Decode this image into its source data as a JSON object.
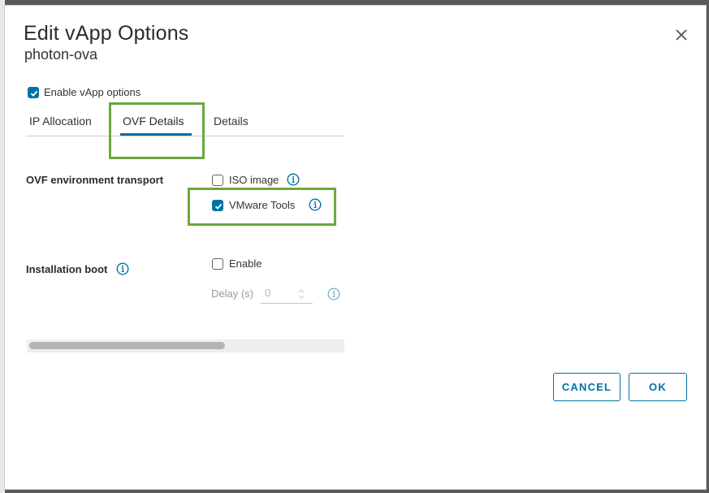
{
  "dialog": {
    "title": "Edit vApp Options",
    "subtitle": "photon-ova",
    "close_icon": "close-icon"
  },
  "enable_vapp": {
    "label": "Enable vApp options",
    "checked": true
  },
  "tabs": [
    {
      "label": "IP Allocation",
      "active": false
    },
    {
      "label": "OVF Details",
      "active": true
    },
    {
      "label": "Details",
      "active": false
    }
  ],
  "ovf_transport": {
    "label": "OVF environment transport",
    "options": [
      {
        "label": "ISO image",
        "checked": false,
        "icon": "info-icon"
      },
      {
        "label": "VMware Tools",
        "checked": true,
        "icon": "info-icon"
      }
    ]
  },
  "installation_boot": {
    "label": "Installation boot",
    "icon": "info-icon",
    "enable": {
      "label": "Enable",
      "checked": false
    },
    "delay": {
      "label": "Delay (s)",
      "value": "0",
      "disabled": true
    }
  },
  "buttons": {
    "cancel": "CANCEL",
    "ok": "OK"
  },
  "colors": {
    "accent": "#0072a3",
    "highlight": "#6aa93b"
  }
}
